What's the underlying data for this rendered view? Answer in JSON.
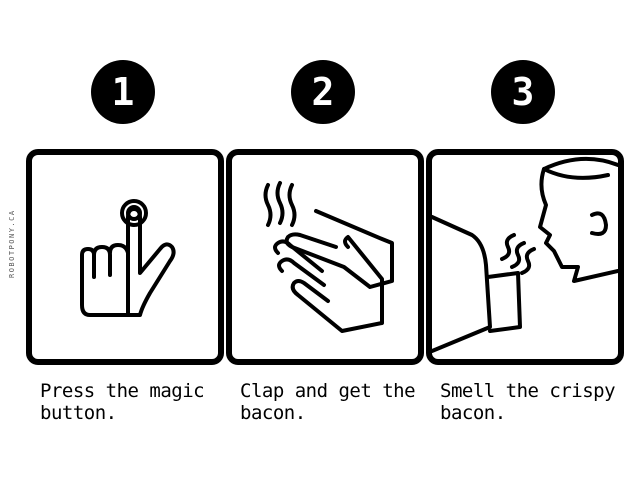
{
  "credit": "ROBOTPONY.CA",
  "steps": [
    {
      "number": "1",
      "caption": "Press the magic\nbutton."
    },
    {
      "number": "2",
      "caption": "Clap and get the\nbacon."
    },
    {
      "number": "3",
      "caption": "Smell the crispy\nbacon."
    }
  ]
}
